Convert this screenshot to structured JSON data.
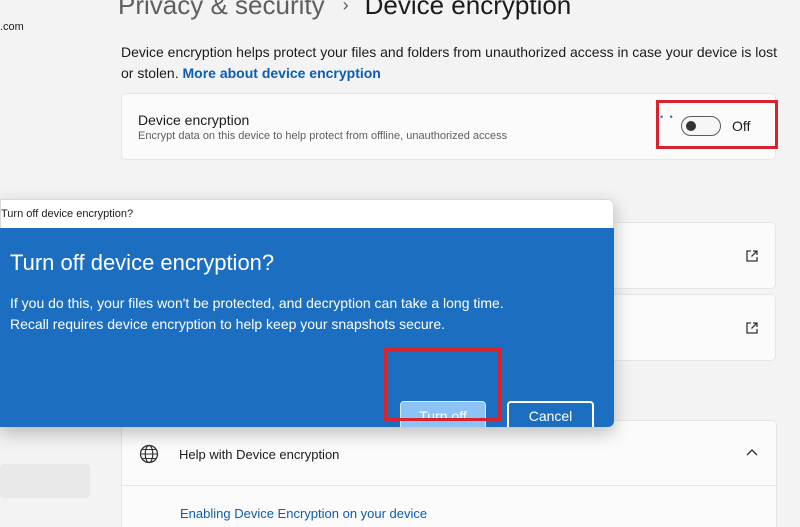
{
  "sidebar": {
    "email_fragment": ".com"
  },
  "breadcrumb": {
    "parent": "Privacy & security",
    "separator": "›",
    "current": "Device encryption"
  },
  "intro": {
    "text": "Device encryption helps protect your files and folders from unauthorized access in case your device is lost or stolen. ",
    "link": "More about device encryption"
  },
  "encryption_setting": {
    "title": "Device encryption",
    "subtitle": "Encrypt data on this device to help protect from offline, unauthorized access",
    "toggle_state": "Off"
  },
  "dialog": {
    "titlebar": "Turn off device encryption?",
    "heading": "Turn off device encryption?",
    "message_line1": "If you do this, your files won't be protected, and decryption can take a long time.",
    "message_line2": "Recall requires device encryption to help keep your snapshots secure.",
    "primary_button": "Turn off",
    "secondary_button": "Cancel"
  },
  "help": {
    "title": "Help with Device encryption",
    "link": "Enabling Device Encryption on your device"
  },
  "icons": {
    "external_link": "external-link-icon",
    "globe": "globe-icon",
    "chevron": "chevron-up-icon"
  },
  "colors": {
    "dialog_bg": "#1c6fc0",
    "link": "#0a5db3",
    "highlight": "#d8222e"
  }
}
